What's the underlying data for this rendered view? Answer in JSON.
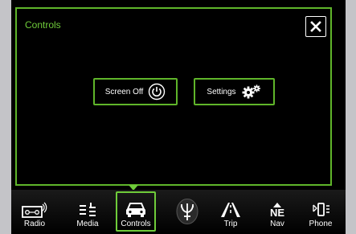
{
  "panel": {
    "title": "Controls"
  },
  "buttons": {
    "screen_off_label": "Screen Off",
    "settings_label": "Settings"
  },
  "nav": {
    "items": [
      {
        "label": "Radio",
        "icon": "radio-icon"
      },
      {
        "label": "Media",
        "icon": "media-icon"
      },
      {
        "label": "Controls",
        "icon": "car-icon",
        "active": true
      },
      {
        "label": "",
        "icon": "trident-logo-icon"
      },
      {
        "label": "Trip",
        "icon": "road-icon"
      },
      {
        "label": "Nav",
        "icon": "compass-icon",
        "compass_text": "NE"
      },
      {
        "label": "Phone",
        "icon": "phone-icon"
      }
    ]
  },
  "colors": {
    "accent": "#6fcc3a",
    "background": "#000000",
    "bezel": "#c4c4c8"
  }
}
